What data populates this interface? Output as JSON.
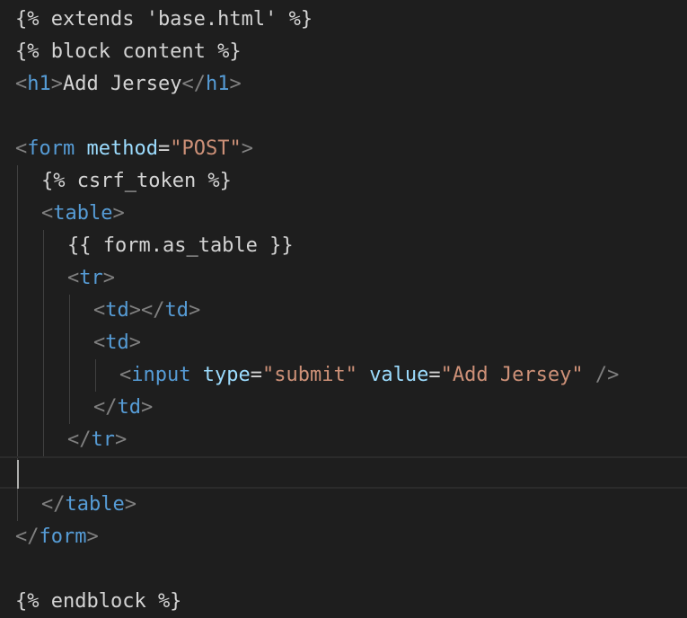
{
  "theme": {
    "background": "#1e1e1e",
    "colors": {
      "plain": "#d4d4d4",
      "bracket": "#808080",
      "tag": "#569cd6",
      "attr": "#9cdcfe",
      "string": "#ce9178"
    }
  },
  "editor": {
    "language": "django-html",
    "lines": [
      {
        "indent": 0,
        "tokens": [
          {
            "t": "{% extends 'base.html' %}",
            "k": "plain"
          }
        ]
      },
      {
        "indent": 0,
        "tokens": [
          {
            "t": "{% block content %}",
            "k": "plain"
          }
        ]
      },
      {
        "indent": 0,
        "tokens": [
          {
            "t": "<",
            "k": "bracket"
          },
          {
            "t": "h1",
            "k": "tag"
          },
          {
            "t": ">",
            "k": "bracket"
          },
          {
            "t": "Add Jersey",
            "k": "plain"
          },
          {
            "t": "</",
            "k": "bracket"
          },
          {
            "t": "h1",
            "k": "tag"
          },
          {
            "t": ">",
            "k": "bracket"
          }
        ]
      },
      {
        "indent": 0,
        "tokens": []
      },
      {
        "indent": 0,
        "tokens": [
          {
            "t": "<",
            "k": "bracket"
          },
          {
            "t": "form",
            "k": "tag"
          },
          {
            "t": " ",
            "k": "plain"
          },
          {
            "t": "method",
            "k": "attr"
          },
          {
            "t": "=",
            "k": "plain"
          },
          {
            "t": "\"POST\"",
            "k": "string"
          },
          {
            "t": ">",
            "k": "bracket"
          }
        ]
      },
      {
        "indent": 1,
        "tokens": [
          {
            "t": "{% csrf_token %}",
            "k": "plain"
          }
        ]
      },
      {
        "indent": 1,
        "tokens": [
          {
            "t": "<",
            "k": "bracket"
          },
          {
            "t": "table",
            "k": "tag"
          },
          {
            "t": ">",
            "k": "bracket"
          }
        ]
      },
      {
        "indent": 2,
        "tokens": [
          {
            "t": "{{ form.as_table }}",
            "k": "plain"
          }
        ]
      },
      {
        "indent": 2,
        "tokens": [
          {
            "t": "<",
            "k": "bracket"
          },
          {
            "t": "tr",
            "k": "tag"
          },
          {
            "t": ">",
            "k": "bracket"
          }
        ]
      },
      {
        "indent": 3,
        "tokens": [
          {
            "t": "<",
            "k": "bracket"
          },
          {
            "t": "td",
            "k": "tag"
          },
          {
            "t": "></",
            "k": "bracket"
          },
          {
            "t": "td",
            "k": "tag"
          },
          {
            "t": ">",
            "k": "bracket"
          }
        ]
      },
      {
        "indent": 3,
        "tokens": [
          {
            "t": "<",
            "k": "bracket"
          },
          {
            "t": "td",
            "k": "tag"
          },
          {
            "t": ">",
            "k": "bracket"
          }
        ]
      },
      {
        "indent": 4,
        "tokens": [
          {
            "t": "<",
            "k": "bracket"
          },
          {
            "t": "input",
            "k": "tag"
          },
          {
            "t": " ",
            "k": "plain"
          },
          {
            "t": "type",
            "k": "attr"
          },
          {
            "t": "=",
            "k": "plain"
          },
          {
            "t": "\"submit\"",
            "k": "string"
          },
          {
            "t": " ",
            "k": "plain"
          },
          {
            "t": "value",
            "k": "attr"
          },
          {
            "t": "=",
            "k": "plain"
          },
          {
            "t": "\"Add Jersey\"",
            "k": "string"
          },
          {
            "t": " ",
            "k": "plain"
          },
          {
            "t": "/>",
            "k": "bracket"
          }
        ]
      },
      {
        "indent": 3,
        "tokens": [
          {
            "t": "</",
            "k": "bracket"
          },
          {
            "t": "td",
            "k": "tag"
          },
          {
            "t": ">",
            "k": "bracket"
          }
        ]
      },
      {
        "indent": 2,
        "tokens": [
          {
            "t": "</",
            "k": "bracket"
          },
          {
            "t": "tr",
            "k": "tag"
          },
          {
            "t": ">",
            "k": "bracket"
          }
        ]
      },
      {
        "indent": 1,
        "cursor": true,
        "tokens": []
      },
      {
        "indent": 1,
        "tokens": [
          {
            "t": "</",
            "k": "bracket"
          },
          {
            "t": "table",
            "k": "tag"
          },
          {
            "t": ">",
            "k": "bracket"
          }
        ]
      },
      {
        "indent": 0,
        "tokens": [
          {
            "t": "</",
            "k": "bracket"
          },
          {
            "t": "form",
            "k": "tag"
          },
          {
            "t": ">",
            "k": "bracket"
          }
        ]
      },
      {
        "indent": 0,
        "tokens": []
      },
      {
        "indent": 0,
        "tokens": [
          {
            "t": "{% endblock %}",
            "k": "plain"
          }
        ]
      }
    ]
  }
}
